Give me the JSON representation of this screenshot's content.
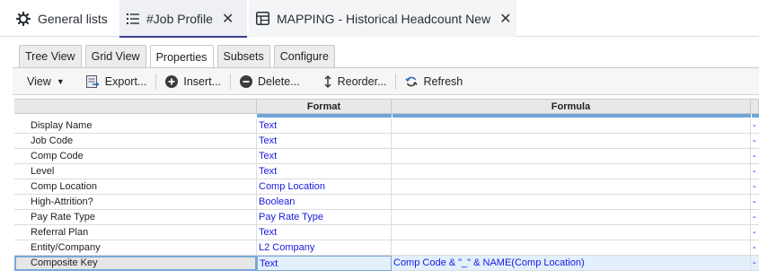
{
  "doc_tabs": [
    {
      "label": "General lists",
      "icon": "gear-icon",
      "closable": false
    },
    {
      "label": "#Job Profile",
      "icon": "list-icon",
      "closable": true
    },
    {
      "label": "MAPPING - Historical Headcount New",
      "icon": "grid-icon",
      "closable": true
    }
  ],
  "sub_tabs": [
    "Tree View",
    "Grid View",
    "Properties",
    "Subsets",
    "Configure"
  ],
  "active_sub_tab": "Properties",
  "toolbar": {
    "view": "View",
    "export": "Export...",
    "insert": "Insert...",
    "delete": "Delete...",
    "reorder": "Reorder...",
    "refresh": "Refresh"
  },
  "grid": {
    "headers": {
      "format": "Format",
      "formula": "Formula"
    },
    "rows": [
      {
        "name": "Display Name",
        "format": "Text",
        "formula": "",
        "extra": "-"
      },
      {
        "name": "Job Code",
        "format": "Text",
        "formula": "",
        "extra": "-"
      },
      {
        "name": "Comp Code",
        "format": "Text",
        "formula": "",
        "extra": "-"
      },
      {
        "name": "Level",
        "format": "Text",
        "formula": "",
        "extra": "-"
      },
      {
        "name": "Comp Location",
        "format": "Comp Location",
        "formula": "",
        "extra": "-"
      },
      {
        "name": "High-Attrition?",
        "format": "Boolean",
        "formula": "",
        "extra": "-"
      },
      {
        "name": "Pay Rate Type",
        "format": "Pay Rate Type",
        "formula": "",
        "extra": "-"
      },
      {
        "name": "Referral Plan",
        "format": "Text",
        "formula": "",
        "extra": "-"
      },
      {
        "name": "Entity/Company",
        "format": "L2 Company",
        "formula": "",
        "extra": "-"
      },
      {
        "name": "Composite Key",
        "format": "Text",
        "formula": "Comp Code & \"_\" & NAME(Comp Location)",
        "extra": "-"
      }
    ]
  },
  "colors": {
    "accent": "#3a3f8f",
    "value_blue": "#1a1ae0",
    "header_bar": "#6fa3d8"
  }
}
